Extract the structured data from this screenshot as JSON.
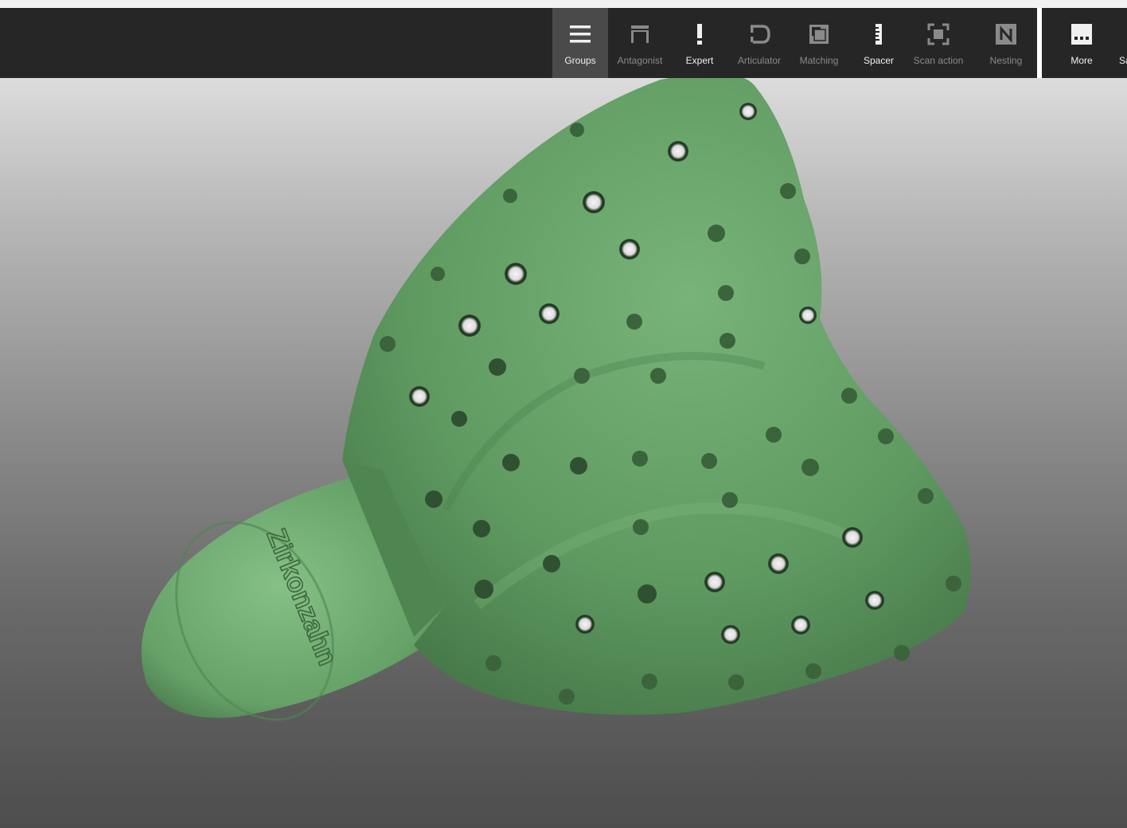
{
  "toolbar": {
    "buttons": [
      {
        "label": "Groups",
        "icon": "hamburger-icon",
        "state": "active"
      },
      {
        "label": "Antagonist",
        "icon": "antagonist-icon",
        "state": "dim"
      },
      {
        "label": "Expert",
        "icon": "exclamation-icon",
        "state": "bright"
      },
      {
        "label": "Articulator",
        "icon": "articulator-icon",
        "state": "dim"
      },
      {
        "label": "Matching",
        "icon": "matching-icon",
        "state": "dim"
      },
      {
        "label": "Spacer",
        "icon": "spacer-ruler-icon",
        "state": "bright"
      },
      {
        "label": "Scan action",
        "icon": "scan-frame-icon",
        "state": "dim"
      },
      {
        "label": "Nesting",
        "icon": "nesting-n-icon",
        "state": "dim"
      },
      {
        "label": "More",
        "icon": "more-dots-icon",
        "state": "bright"
      },
      {
        "label": "Sa",
        "icon": "",
        "state": "bright"
      }
    ]
  },
  "viewport": {
    "model_color": "#5f9a61",
    "model_label": "Zirkonzahn"
  }
}
